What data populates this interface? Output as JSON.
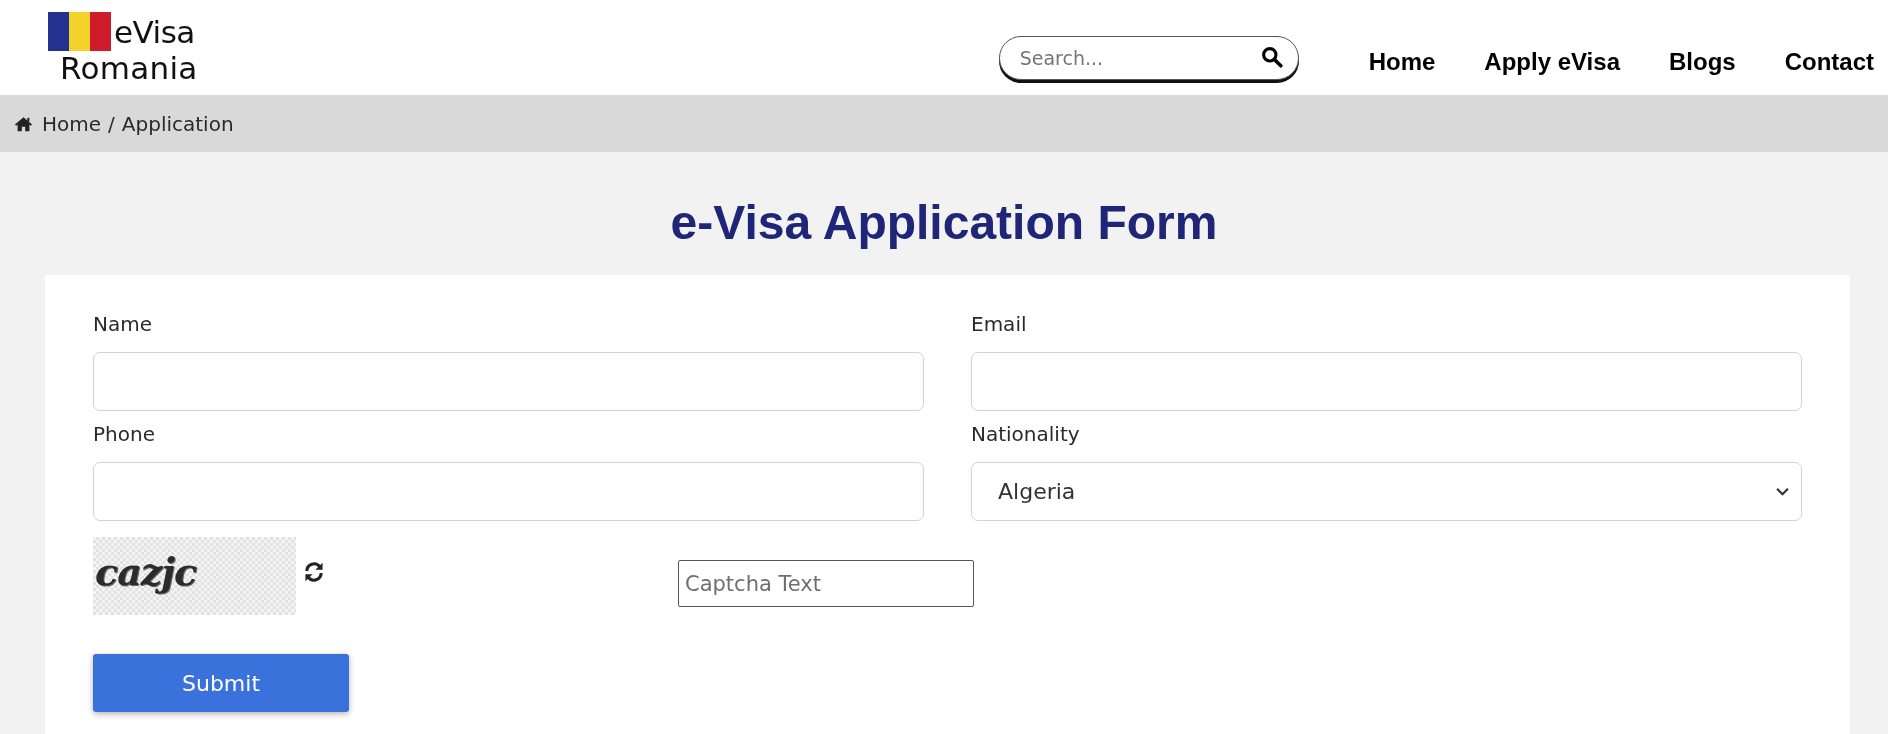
{
  "header": {
    "logo": {
      "line_1": "eVisa",
      "line_2": "Romania"
    },
    "search": {
      "placeholder": "Search..."
    },
    "nav": [
      {
        "label": "Home"
      },
      {
        "label": "Apply eVisa"
      },
      {
        "label": "Blogs"
      },
      {
        "label": "Contact"
      }
    ]
  },
  "breadcrumb": {
    "items": [
      {
        "label": "Home"
      },
      {
        "label": "Application"
      }
    ],
    "separator": "/"
  },
  "title": "e-Visa Application Form",
  "form": {
    "fields": [
      {
        "label": "Name",
        "kind": "text"
      },
      {
        "label": "Email",
        "kind": "text"
      },
      {
        "label": "Phone",
        "kind": "text"
      },
      {
        "label": "Nationality",
        "kind": "select",
        "value": "Algeria"
      }
    ],
    "captcha": {
      "code": "cazjc",
      "placeholder": "Captcha Text"
    },
    "submit": "Submit"
  }
}
